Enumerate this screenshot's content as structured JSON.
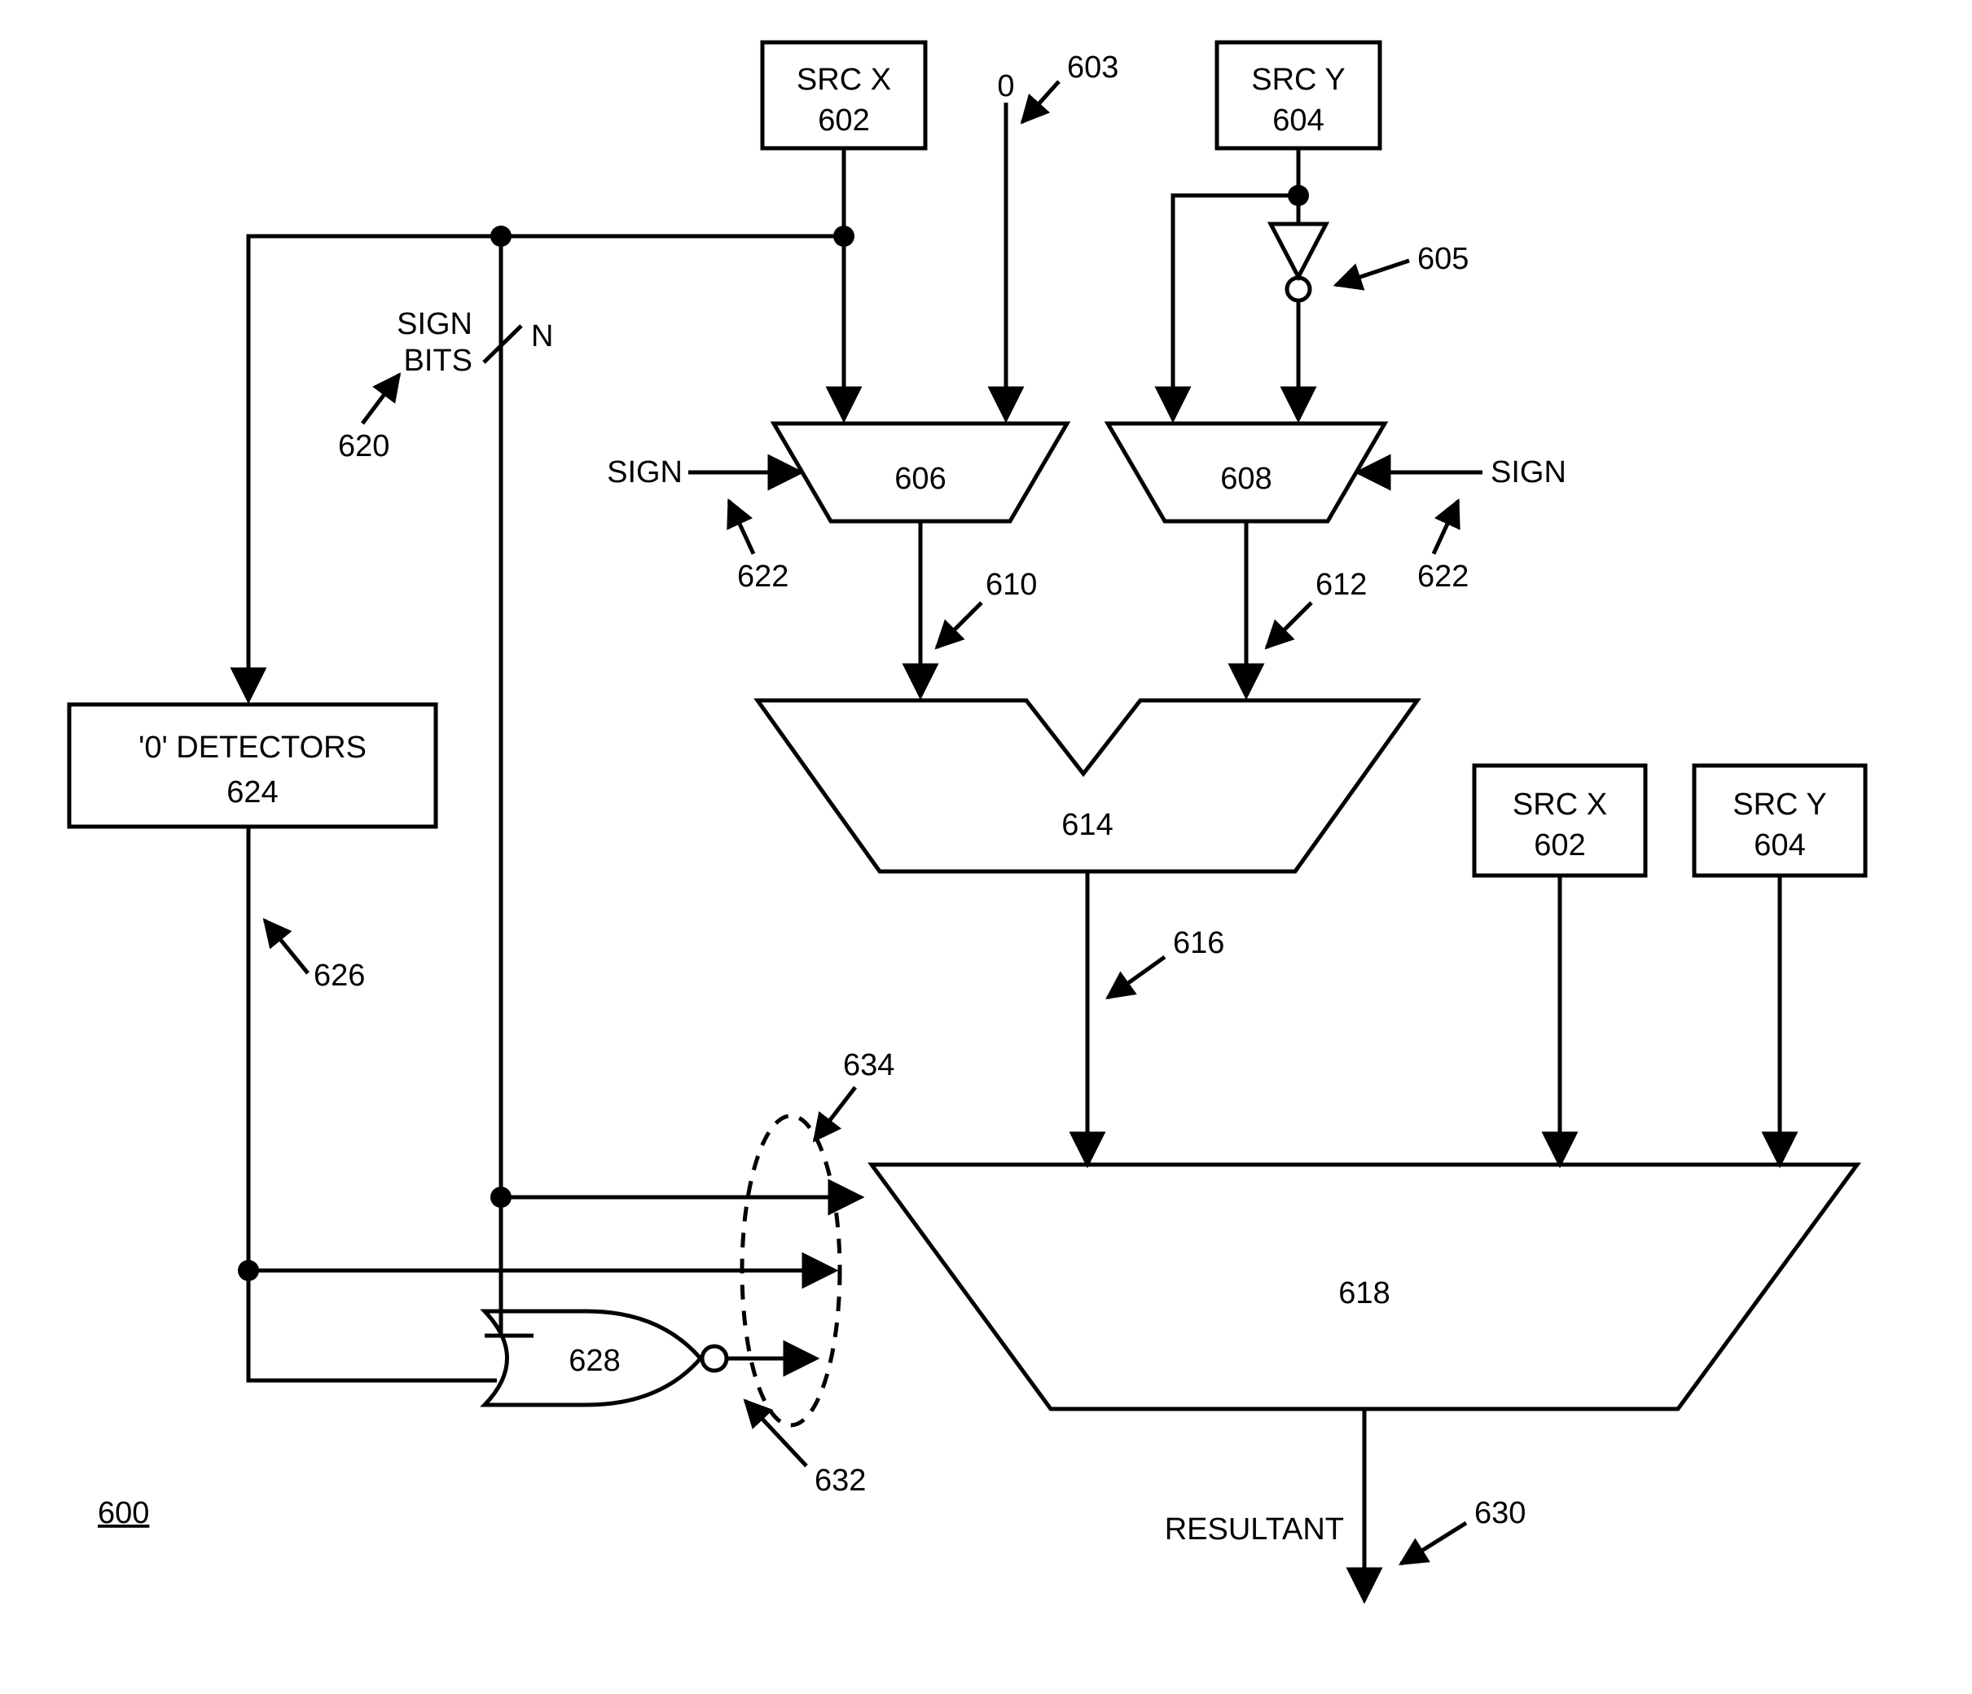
{
  "figure_id": "600",
  "blocks": {
    "srcx_top": {
      "line1": "SRC X",
      "line2": "602"
    },
    "srcy_top": {
      "line1": "SRC Y",
      "line2": "604"
    },
    "srcx_r": {
      "line1": "SRC X",
      "line2": "602"
    },
    "srcy_r": {
      "line1": "SRC Y",
      "line2": "604"
    },
    "zero_det": {
      "line1": "'0' DETECTORS",
      "line2": "624"
    },
    "mux606": "606",
    "mux608": "608",
    "adder614": "614",
    "mux618": "618",
    "nor628": "628"
  },
  "labels": {
    "zero_input": "0",
    "sign_left": "SIGN",
    "sign_right": "SIGN",
    "sign_bits1": "SIGN",
    "sign_bits2": "BITS",
    "n": "N",
    "resultant": "RESULTANT"
  },
  "refs": {
    "r603": "603",
    "r605": "605",
    "r610": "610",
    "r612": "612",
    "r616": "616",
    "r620": "620",
    "r622a": "622",
    "r622b": "622",
    "r626": "626",
    "r630": "630",
    "r632": "632",
    "r634": "634"
  }
}
